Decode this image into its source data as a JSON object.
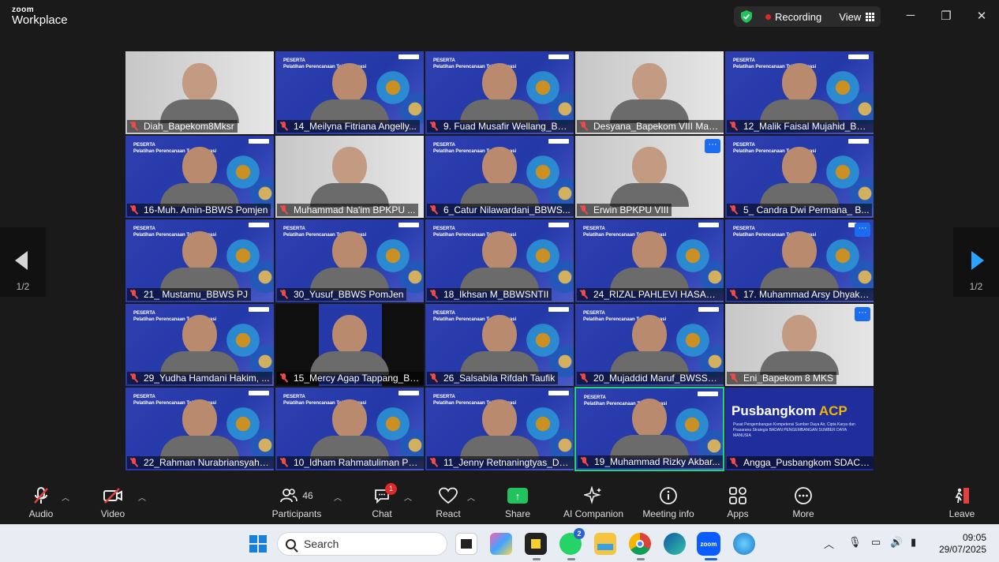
{
  "app": {
    "brand_top": "zoom",
    "brand_bottom": "Workplace"
  },
  "titlebar": {
    "recording_label": "Recording",
    "view_label": "View",
    "minimize": "─",
    "restore": "❐",
    "close": "✕"
  },
  "nav": {
    "prev_page": "1/2",
    "next_page": "1/2"
  },
  "participants": [
    {
      "name": "Diah_Bapekom8Mksr",
      "style": "grey"
    },
    {
      "name": "14_Meilyna Fitriana Angelly...",
      "style": "blue"
    },
    {
      "name": "9. Fuad Musafir Wellang_BB...",
      "style": "blue"
    },
    {
      "name": "Desyana_Bapekom VIII Mak...",
      "style": "grey"
    },
    {
      "name": "12_Malik Faisal Mujahid_BB...",
      "style": "blue"
    },
    {
      "name": "16-Muh. Amin-BBWS Pomjen",
      "style": "blue"
    },
    {
      "name": "Muhammad Na'im BPKPU ...",
      "style": "grey"
    },
    {
      "name": "6_Catur Nilawardani_BBWS...",
      "style": "blue"
    },
    {
      "name": "Erwin BPKPU VIII",
      "style": "grey"
    },
    {
      "name": "5_ Candra Dwi Permana_ B...",
      "style": "blue"
    },
    {
      "name": "21_ Mustamu_BBWS PJ",
      "style": "blue"
    },
    {
      "name": "30_Yusuf_BBWS PomJen",
      "style": "blue"
    },
    {
      "name": "18_Ikhsan M_BBWSNTII",
      "style": "blue"
    },
    {
      "name": "24_RIZAL PAHLEVI HASANU...",
      "style": "blue"
    },
    {
      "name": "17. Muhammad Arsy Dhyaks...",
      "style": "blue"
    },
    {
      "name": "29_Yudha Hamdani Hakim, ...",
      "style": "blue"
    },
    {
      "name": "15_Mercy Agap Tappang_BB...",
      "style": "dark"
    },
    {
      "name": "26_Salsabila Rifdah Taufik",
      "style": "blue"
    },
    {
      "name": "20_Mujaddid Maruf_BWSSul...",
      "style": "blue"
    },
    {
      "name": "Eni_Bapekom 8 MKS",
      "style": "grey"
    },
    {
      "name": "22_Rahman Nurabriansyah_...",
      "style": "blue"
    },
    {
      "name": "10_Idham Rahmatuliman Pu...",
      "style": "blue"
    },
    {
      "name": "11_Jenny Retnaningtyas_Dit...",
      "style": "blue"
    },
    {
      "name": "19_Muhammad Rizky Akbar...",
      "style": "blue"
    },
    {
      "name": "Angga_Pusbangkom SDACK...",
      "style": "pusb"
    }
  ],
  "slide": {
    "line1": "PESERTA",
    "line2": "Pelatihan Perencanaan Teknis Irigasi"
  },
  "pusbangkom": {
    "title_a": "Pusbangkom ",
    "title_b": "ACP",
    "subtitle": "Pusat Pengembangan Kompetensi Sumber Daya Air, Cipta Karya dan Prasarana Strategis BADAN PENGEMBANGAN SUMBER DAYA MANUSIA"
  },
  "more_dots": "···",
  "toolbar": {
    "audio": "Audio",
    "video": "Video",
    "participants": "Participants",
    "participants_count": "46",
    "chat": "Chat",
    "chat_badge": "1",
    "react": "React",
    "share": "Share",
    "ai_companion": "AI Companion",
    "meeting_info": "Meeting info",
    "apps": "Apps",
    "more": "More",
    "leave": "Leave"
  },
  "taskbar": {
    "search_label": "Search",
    "whatsapp_badge": "2",
    "zoom_label": "zoom",
    "time": "09:05",
    "date": "29/07/2025"
  },
  "colors": {
    "tile_blue": "#2438a8",
    "active_border": "#23d57a",
    "share_green": "#22c35e",
    "leave_red": "#e34040"
  }
}
